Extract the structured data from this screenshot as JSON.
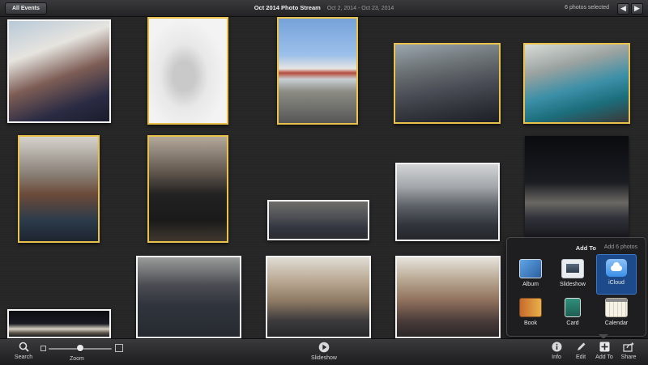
{
  "topbar": {
    "back_label": "All Events",
    "title": "Oct 2014 Photo Stream",
    "date_range": "Oct 2, 2014 - Oct 23, 2014",
    "selection": "6 photos selected",
    "prev_symbol": "◀",
    "next_symbol": "▶"
  },
  "photos": [
    {
      "id": 1,
      "selected": false,
      "subject": ""
    },
    {
      "id": 2,
      "selected": true
    },
    {
      "id": 3,
      "selected": true
    },
    {
      "id": 4,
      "selected": true
    },
    {
      "id": 5,
      "selected": true
    },
    {
      "id": 6,
      "selected": true
    },
    {
      "id": 7,
      "selected": true
    },
    {
      "id": 8,
      "selected": false
    },
    {
      "id": 9,
      "selected": false
    },
    {
      "id": 10,
      "selected": false
    },
    {
      "id": 11,
      "selected": false
    },
    {
      "id": 12,
      "selected": false
    },
    {
      "id": 13,
      "selected": false
    },
    {
      "id": 14,
      "selected": false
    }
  ],
  "toolbar": {
    "search": "Search",
    "zoom": "Zoom",
    "zoom_level": 0.5,
    "slideshow": "Slideshow",
    "info": "Info",
    "edit": "Edit",
    "add_to": "Add To",
    "share": "Share"
  },
  "popover": {
    "title": "Add To",
    "subtitle": "Add 6 photos",
    "items": [
      {
        "label": "Album",
        "icon": "album-icon"
      },
      {
        "label": "Slideshow",
        "icon": "slideshow-icon"
      },
      {
        "label": "iCloud",
        "icon": "icloud-icon",
        "active": true
      },
      {
        "label": "Book",
        "icon": "book-icon"
      },
      {
        "label": "Card",
        "icon": "card-icon"
      },
      {
        "label": "Calendar",
        "icon": "calendar-icon"
      }
    ]
  },
  "colors": {
    "selection_border": "#e8c24a",
    "active_item": "#1c4a8a",
    "icloud_blue": "#3a8fe8"
  }
}
